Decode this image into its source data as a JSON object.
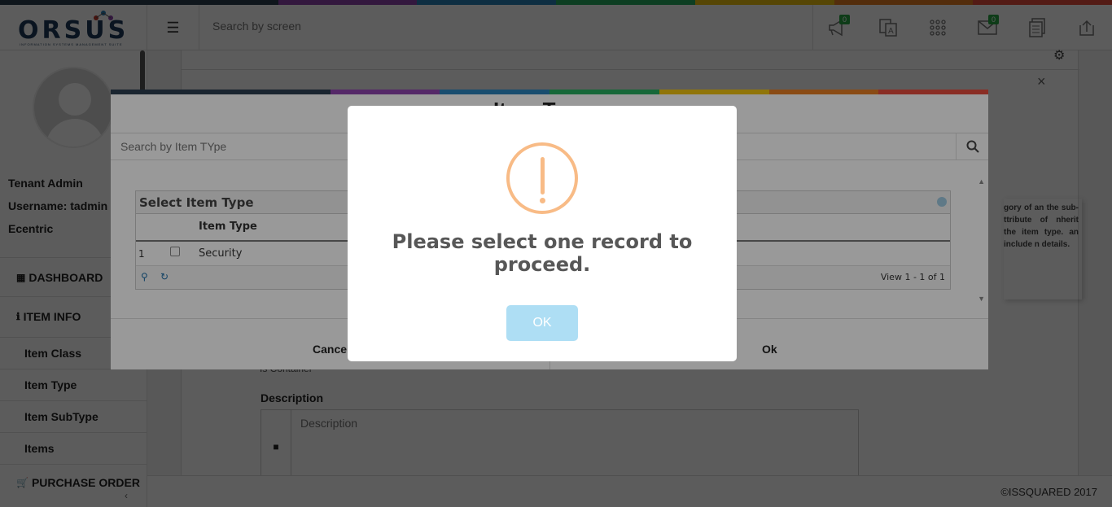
{
  "colors": {
    "rainbow": [
      "#2c3e50",
      "#8e44ad",
      "#2980b9",
      "#27ae60",
      "#f1c40f",
      "#e67e22",
      "#e74c3c"
    ],
    "alert_accent": "#f8bb86",
    "alert_button": "#aedef4",
    "badge": "#28a745"
  },
  "header": {
    "logo_text": "ORSUS",
    "logo_subtitle": "INFORMATION SYSTEMS MANAGEMENT SUITE",
    "menu_icon": "hamburger-icon",
    "search_placeholder": "Search by screen",
    "icons": [
      {
        "name": "announcement-icon",
        "badge": "0"
      },
      {
        "name": "translate-icon",
        "badge": ""
      },
      {
        "name": "apps-grid-icon",
        "badge": ""
      },
      {
        "name": "mail-icon",
        "badge": "0"
      },
      {
        "name": "report-icon",
        "badge": ""
      },
      {
        "name": "upload-icon",
        "badge": ""
      }
    ]
  },
  "sidebar": {
    "user_role": "Tenant Admin",
    "username": "Username: tadmin",
    "org": "Ecentric",
    "nav": [
      {
        "label": "DASHBOARD",
        "icon": "dashboard-icon"
      },
      {
        "label": "ITEM INFO",
        "icon": "info-icon"
      },
      {
        "label": "Item Class"
      },
      {
        "label": "Item Type"
      },
      {
        "label": "Item SubType"
      },
      {
        "label": "Items"
      },
      {
        "label": "PURCHASE ORDER",
        "icon": "cart-icon"
      }
    ]
  },
  "main": {
    "help_text": "gory of an the sub- ttribute of nherit the item type. an include n details.",
    "is_container_label": "Is Container",
    "description_label": "Description",
    "description_placeholder": "Description"
  },
  "footer": {
    "copyright": "©ISSQUARED 2017"
  },
  "modal": {
    "title": "Item Type",
    "search_placeholder": "Search by Item TYpe",
    "grid_caption": "Select Item Type",
    "column_header": "Item Type",
    "rows": [
      {
        "num": "1",
        "value": "Security"
      }
    ],
    "pager_text": "View 1 - 1 of 1",
    "cancel_label": "Cancel",
    "ok_label": "Ok"
  },
  "alert": {
    "message": "Please select one record to proceed.",
    "ok_label": "OK"
  }
}
